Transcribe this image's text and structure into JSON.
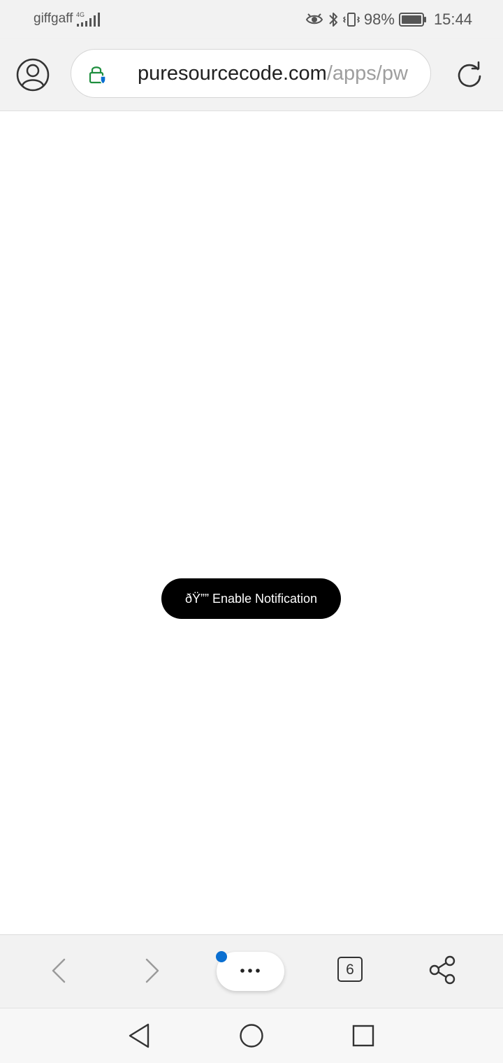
{
  "status_bar": {
    "carrier": "giffgaff",
    "network": "4G",
    "battery_percent": "98%",
    "time": "15:44",
    "icons": [
      "signal-icon",
      "eye-comfort-icon",
      "bluetooth-icon",
      "vibrate-icon",
      "battery-icon"
    ]
  },
  "address_bar": {
    "domain": "puresourcecode.com",
    "path": "/apps/pw",
    "icons": [
      "profile-icon",
      "lock-shield-icon",
      "reload-icon"
    ]
  },
  "page": {
    "notify_button_label": "ðŸ”” Enable Notification"
  },
  "bottom_toolbar": {
    "tab_count": "6",
    "icons": [
      "back-arrow-icon",
      "forward-arrow-icon",
      "more-dots-icon",
      "share-icon"
    ]
  },
  "system_nav": {
    "icons": [
      "nav-back-icon",
      "nav-home-icon",
      "nav-recents-icon"
    ]
  },
  "colors": {
    "chrome_bg": "#f2f2f2",
    "lock_green": "#1e8e3e",
    "shield_blue": "#0a6fd1",
    "badge_blue": "#0a6fd1",
    "button_black": "#000000"
  }
}
